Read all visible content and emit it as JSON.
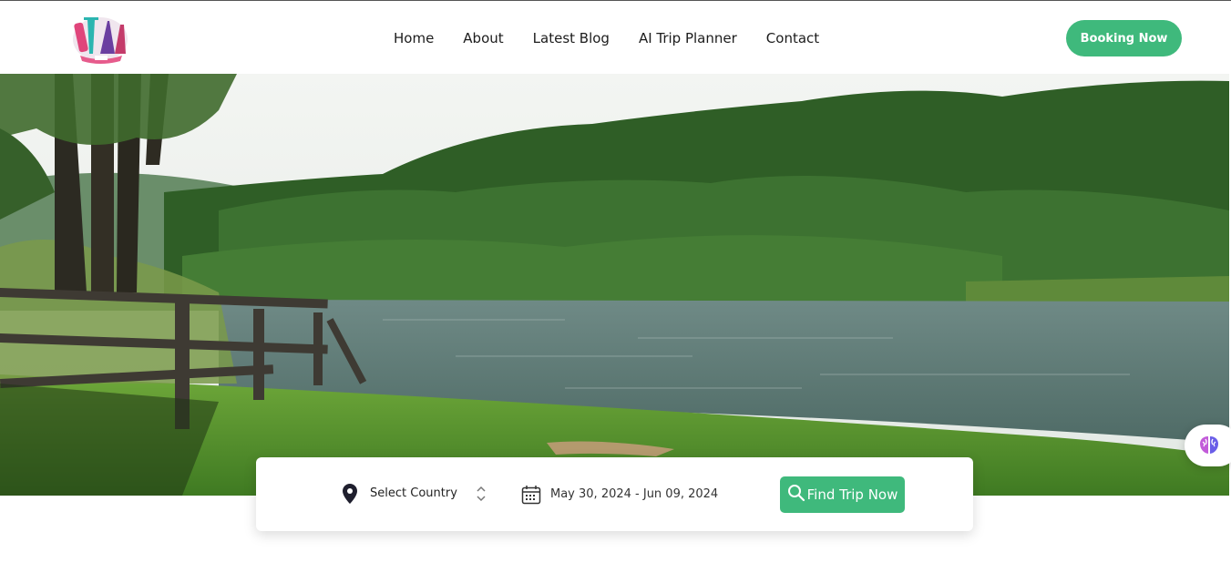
{
  "header": {
    "logo_icon": "travel-landmarks-logo",
    "nav": [
      "Home",
      "About",
      "Latest Blog",
      "AI Trip Planner",
      "Contact"
    ],
    "cta_label": "Booking Now"
  },
  "hero": {
    "image": "lake-forest-landscape"
  },
  "search": {
    "country_placeholder": "Select Country",
    "date_range": "May 30, 2024 - Jun 09, 2024",
    "button_label": "Find Trip Now",
    "icons": [
      "location-pin-icon",
      "up-down-chevron-icon",
      "calendar-icon",
      "search-icon"
    ]
  },
  "colors": {
    "accent": "#3fb97c",
    "text": "#1c1c1c"
  },
  "floating": {
    "icon": "brain-icon"
  }
}
